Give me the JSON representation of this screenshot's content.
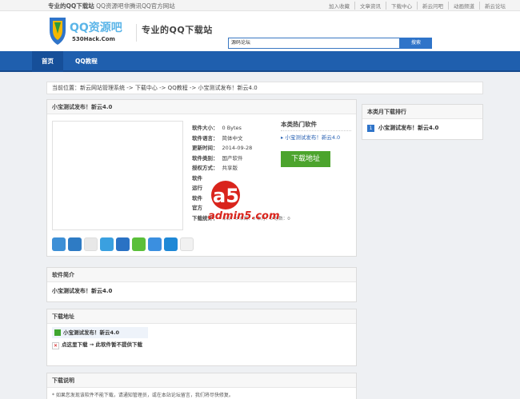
{
  "topbar": {
    "left_bold": "专业的QQ下载站",
    "left_rest": " QQ资源吧非腾讯QQ官方网站",
    "links": [
      "加入收藏",
      "文章资讯",
      "下载中心",
      "新云问吧",
      "动画频道",
      "新云论坛"
    ]
  },
  "header": {
    "logo_title": "QQ资源吧",
    "logo_sub": "530Hack.Com",
    "slogan": "专业的QQ下载站",
    "search_value": "源码论坛",
    "search_button": "搜索"
  },
  "nav": [
    "首页",
    "QQ教程"
  ],
  "breadcrumb": "当前位置：新云网站管理系统 -> 下载中心 -> QQ教程 -> 小宝测试发布！新云4.0",
  "detail": {
    "title": "小宝测试发布！新云4.0",
    "info": [
      {
        "label": "软件大小：",
        "value": "0 Bytes"
      },
      {
        "label": "软件语言：",
        "value": "简体中文"
      },
      {
        "label": "更新时间：",
        "value": "2014-09-28"
      },
      {
        "label": "软件类别：",
        "value": "国产软件"
      },
      {
        "label": "授权方式：",
        "value": "共享版"
      },
      {
        "label": "软件",
        "value": ""
      },
      {
        "label": "运行",
        "value": ""
      },
      {
        "label": "软件",
        "value": ""
      },
      {
        "label": "官方",
        "value": ""
      },
      {
        "label": "下载统计：",
        "value": "本日：0 本周：0 本月：0 总数：0"
      }
    ],
    "hot_title": "本类热门软件",
    "hot_items": [
      "小宝测试发布！新云4.0"
    ],
    "download_button": "下载地址"
  },
  "sidebar": {
    "title": "本类月下载排行",
    "items": [
      {
        "rank": "1",
        "name": "小宝测试发布！新云4.0"
      }
    ]
  },
  "intro": {
    "title": "软件简介",
    "text": "小宝测试发布！新云4.0"
  },
  "downloads": {
    "title": "下载地址",
    "file_name": "小宝测试发布！新云4.0",
    "note": "点这里下载 → 此软件暂不提供下载"
  },
  "instructions": {
    "title": "下载说明",
    "text": "* 如果您发现该软件不能下载，请通知管理员，或在本站论坛留言，我们将尽快修复。"
  },
  "watermark": {
    "brand": "a5下载",
    "site": "admin5.com"
  },
  "colors": {
    "nav": "#1f5fae",
    "accent": "#2f74c9",
    "download": "#4ca42d",
    "link": "#2a62b3"
  }
}
